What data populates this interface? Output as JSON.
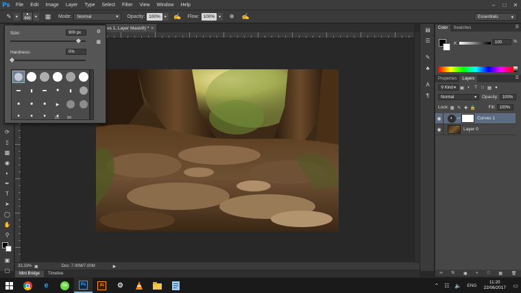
{
  "app": {
    "logo": "Ps"
  },
  "menu": [
    "File",
    "Edit",
    "Image",
    "Layer",
    "Type",
    "Select",
    "Filter",
    "View",
    "Window",
    "Help"
  ],
  "window_controls": [
    "minimize",
    "maximize",
    "close"
  ],
  "options_bar": {
    "brush_size": "900",
    "mode_label": "Mode:",
    "mode_value": "Normal",
    "opacity_label": "Opacity:",
    "opacity_value": "100%",
    "flow_label": "Flow:",
    "flow_value": "100%",
    "workspace": "Essentials"
  },
  "brush_popup": {
    "size_label": "Size:",
    "size_value": "900 px",
    "size_fraction": 0.9,
    "hardness_label": "Hardness:",
    "hardness_value": "0%",
    "hardness_fraction": 0.0,
    "preset_numbers": [
      "25",
      "50"
    ]
  },
  "document": {
    "tab_title": "es 1, Layer Mask/8) *",
    "zoom": "33.33%",
    "doc_info": "Doc: 7.00M/7.00M"
  },
  "bottom_tabs": [
    "Mini Bridge",
    "Timeline"
  ],
  "color_panel": {
    "tabs": [
      "Color",
      "Swatches"
    ],
    "channel_label": "K",
    "channel_value": "100",
    "channel_unit": "%"
  },
  "layers_panel": {
    "tabs": [
      "Properties",
      "Layers"
    ],
    "filter_kind": "Kind",
    "blend_mode": "Normal",
    "opacity_label": "Opacity:",
    "opacity_value": "100%",
    "lock_label": "Lock:",
    "fill_label": "Fill:",
    "fill_value": "100%",
    "layers": [
      {
        "name": "Curves 1",
        "selected": true
      },
      {
        "name": "Layer 0",
        "selected": false
      }
    ]
  },
  "taskbar": {
    "apps": [
      "start",
      "chrome",
      "edge",
      "upwork",
      "photoshop",
      "illustrator",
      "steam",
      "vlc",
      "file-explorer",
      "notepad"
    ],
    "language": "ENG",
    "time": "11:20",
    "date": "22/06/2017"
  }
}
